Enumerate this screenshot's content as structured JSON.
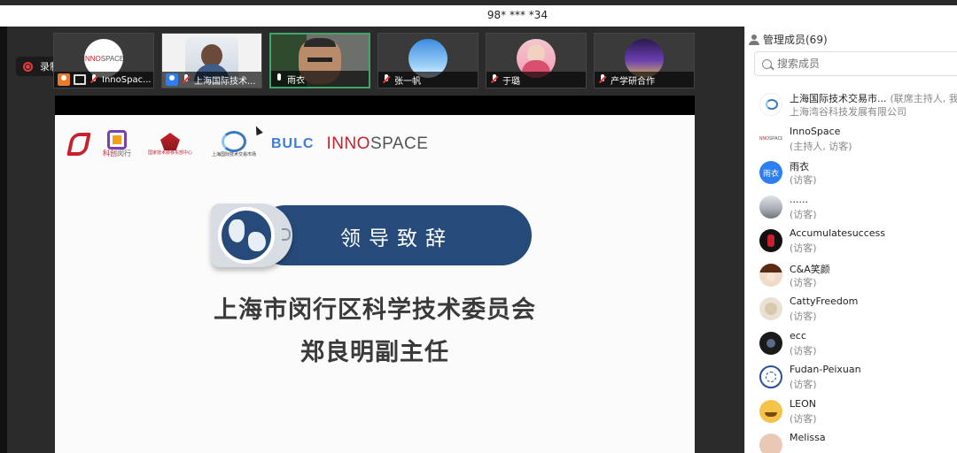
{
  "window": {
    "title": "98* *** *34"
  },
  "recording": {
    "label": "录制中"
  },
  "video_tiles": [
    {
      "name": "InnoSpac...",
      "avatar": "innospace-logo"
    },
    {
      "name": "上海国际技术...",
      "avatar": "host-photo"
    },
    {
      "name": "雨衣",
      "avatar": "speaker-photo"
    },
    {
      "name": "张一帆",
      "avatar": "sky-photo"
    },
    {
      "name": "于璐",
      "avatar": "woman-photo"
    },
    {
      "name": "产学研合作",
      "avatar": "stage-photo"
    }
  ],
  "slide": {
    "logos": [
      "科创",
      "闵行",
      "国家技术转移东部中心",
      "上海国际技术交易市场",
      "BULC",
      "INNOSPACE"
    ],
    "banner_title": "领导致辞",
    "line1": "上海市闵行区科学技术委员会",
    "line2": "郑良明副主任"
  },
  "members_panel": {
    "title": "管理成员(69)",
    "search_placeholder": "搜索成员",
    "members": [
      {
        "name": "上海国际技术交易市...",
        "role": "(联席主持人, 我)",
        "subtitle": "上海湾谷科技发展有限公司",
        "avatar": "host-logo"
      },
      {
        "name": "InnoSpace",
        "role": "(主持人, 访客)",
        "avatar": "innospace-logo"
      },
      {
        "name": "雨衣",
        "role": "(访客)",
        "avatar": "text-avatar",
        "avatar_text": "雨衣"
      },
      {
        "name": "......",
        "role": "(访客)",
        "avatar": "landscape-photo"
      },
      {
        "name": "Accumulatesuccess",
        "role": "(访客)",
        "avatar": "dark-photo"
      },
      {
        "name": "C&A笑颜",
        "role": "(访客)",
        "avatar": "girl-photo"
      },
      {
        "name": "CattyFreedom",
        "role": "(访客)",
        "avatar": "cat-photo"
      },
      {
        "name": "ecc",
        "role": "(访客)",
        "avatar": "dark-photo"
      },
      {
        "name": "Fudan-Peixuan",
        "role": "(访客)",
        "avatar": "seal-logo"
      },
      {
        "name": "LEON",
        "role": "(访客)",
        "avatar": "emoji-photo"
      },
      {
        "name": "Melissa",
        "role": "",
        "avatar": "portrait-photo"
      }
    ]
  },
  "colors": {
    "accent_green": "#3fa56a",
    "banner_navy": "#264b7b",
    "record_red": "#e63b3b",
    "brand_red": "#c8202d"
  }
}
